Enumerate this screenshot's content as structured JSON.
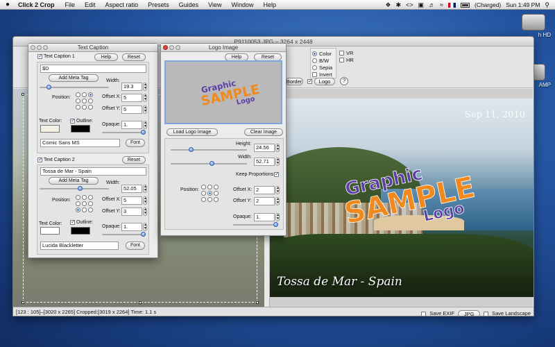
{
  "menubar": {
    "apple": "",
    "app_name": "Click 2 Crop",
    "items": [
      "File",
      "Edit",
      "Aspect ratio",
      "Presets",
      "Guides",
      "View",
      "Window",
      "Help"
    ],
    "battery_status": "(Charged)",
    "clock": "Sun 1:49 PM",
    "tray_icons": [
      "dropbox-icon",
      "bluetooth-icon",
      "code-icon",
      "display-icon",
      "volume-icon",
      "wifi-icon",
      "flag-icon",
      "battery-icon",
      "spotlight-icon"
    ]
  },
  "desktop": {
    "icons": [
      {
        "label": "h HD",
        "icon": "hard-drive-icon"
      },
      {
        "label": "AMP",
        "icon": "hard-drive-icon"
      }
    ]
  },
  "main_window": {
    "title": "P9110053.JPG – 3264 x 2448",
    "color_modes": {
      "options": [
        "Color",
        "B/W",
        "Sepia"
      ],
      "selected": "Color",
      "invert_label": "Invert"
    },
    "flip": {
      "vr_label": "VR",
      "hr_label": "HR"
    },
    "toolbar": {
      "border_label": "Border",
      "logo_label": "Logo",
      "help_label": "?"
    },
    "preview": {
      "date_stamp": "Sep 11, 2010",
      "caption": "Tossa de Mar - Spain",
      "logo": {
        "line1": "Graphic",
        "line2": "SAMPLE",
        "line3": "Logo"
      }
    },
    "status": {
      "coords": "[123 : 105]–[3020 x 2265]",
      "cropped": "Cropped:[3019 x 2264]",
      "time": "Time: 1.1 s",
      "save_exif_label": "Save EXIF",
      "format_label": "JPG",
      "save_landscape_label": "Save Landscape"
    }
  },
  "text_caption_panel": {
    "title": "Text Caption",
    "caption1": {
      "label": "Text Caption 1",
      "help_label": "Help",
      "reset_label": "Reset",
      "text": "$D",
      "add_meta_label": "Add Meta Tag",
      "width_label": "Width:",
      "width": "19.3",
      "position_label": "Position:",
      "offset_x_label": "Offset X:",
      "offset_x": "5",
      "offset_y_label": "Offset Y:",
      "offset_y": "5",
      "text_color_label": "Text Color:",
      "outline_label": "Outline:",
      "opaque_label": "Opaque:",
      "opaque": "1.",
      "font_name": "Comic Sans MS",
      "font_label": "Font"
    },
    "caption2": {
      "label": "Text Caption 2",
      "reset_label": "Reset",
      "text": "Tossa de Mar - Spain",
      "add_meta_label": "Add Meta Tag",
      "width_label": "Width:",
      "width": "52.05",
      "position_label": "Position:",
      "offset_x_label": "Offset X:",
      "offset_x": "5",
      "offset_y_label": "Offset Y:",
      "offset_y": "3",
      "text_color_label": "Text Color:",
      "outline_label": "Outline:",
      "opaque_label": "Opaque:",
      "opaque": "1.",
      "font_name": "Lucida Blackletter",
      "font_label": "Font"
    }
  },
  "logo_image_panel": {
    "title": "Logo Image",
    "help_label": "Help",
    "reset_label": "Reset",
    "load_label": "Load Logo Image",
    "clear_label": "Clear Image",
    "height_label": "Height:",
    "height": "24.56",
    "width_label": "Width:",
    "width": "52.71",
    "keep_proportions_label": "Keep Proportions:",
    "position_label": "Position:",
    "offset_x_label": "Offset X:",
    "offset_x": "2",
    "offset_y_label": "Offset Y:",
    "offset_y": "2",
    "opaque_label": "Opaque:",
    "opaque": "1.",
    "logo": {
      "line1": "Graphic",
      "line2": "SAMPLE",
      "line3": "Logo"
    }
  },
  "colors": {
    "logo_purple": "#5b3fa3",
    "logo_orange": "#f08a1e",
    "accent": "#2a5fc9"
  }
}
